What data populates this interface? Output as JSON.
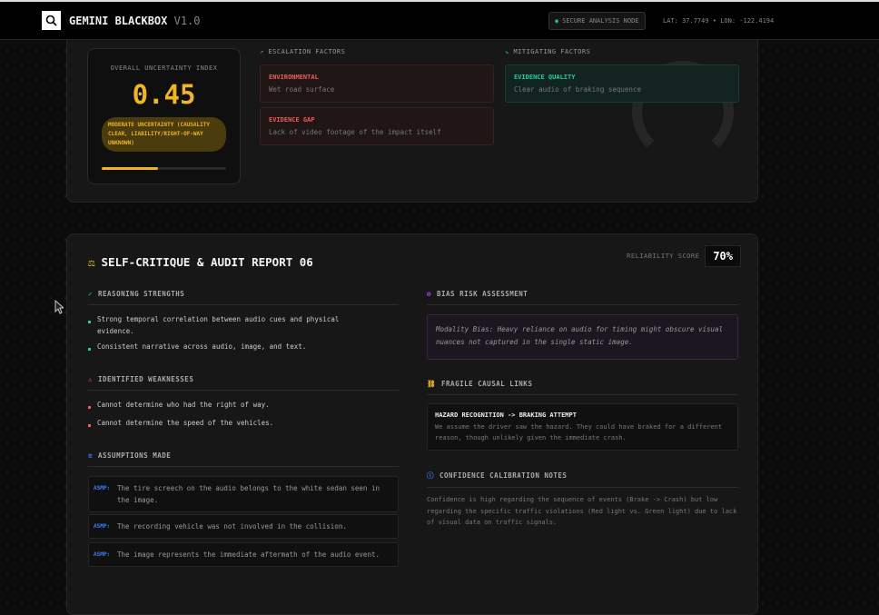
{
  "header": {
    "app_name": "GEMINI BLACKBOX",
    "version": "V1.0",
    "node_label": "SECURE ANALYSIS NODE",
    "coords": "LAT: 37.7749 • LON: -122.4194"
  },
  "uncertainty": {
    "label": "OVERALL UNCERTAINTY INDEX",
    "value": "0.45",
    "status": "MODERATE UNCERTAINTY (CAUSALITY CLEAR, LIABILITY/RIGHT-OF-WAY UNKNOWN)",
    "progress": 0.45,
    "color": "#f0b429"
  },
  "escalation": {
    "title": "ESCALATION FACTORS",
    "items": [
      {
        "title": "ENVIRONMENTAL",
        "desc": "Wet road surface"
      },
      {
        "title": "EVIDENCE GAP",
        "desc": "Lack of video footage of the impact itself"
      }
    ]
  },
  "mitigating": {
    "title": "MITIGATING FACTORS",
    "items": [
      {
        "title": "EVIDENCE QUALITY",
        "desc": "Clear audio of braking sequence"
      }
    ]
  },
  "audit": {
    "title": "SELF-CRITIQUE & AUDIT REPORT 06",
    "reliability_label": "RELIABILITY SCORE",
    "reliability_value": "70%",
    "strengths": {
      "title": "REASONING STRENGTHS",
      "items": [
        "Strong temporal correlation between audio cues and physical evidence.",
        "Consistent narrative across audio, image, and text."
      ]
    },
    "weaknesses": {
      "title": "IDENTIFIED WEAKNESSES",
      "items": [
        "Cannot determine who had the right of way.",
        "Cannot determine the speed of the vehicles."
      ]
    },
    "assumptions": {
      "title": "ASSUMPTIONS MADE",
      "tag": "ASMP:",
      "items": [
        "The tire screech on the audio belongs to the white sedan seen in the image.",
        "The recording vehicle was not involved in the collision.",
        "The image represents the immediate aftermath of the audio event."
      ]
    },
    "bias": {
      "title": "BIAS RISK ASSESSMENT",
      "text": "Modality Bias: Heavy reliance on audio for timing might obscure visual nuances not captured in the single static image."
    },
    "fragile": {
      "title": "FRAGILE CAUSAL LINKS",
      "link": "HAZARD RECOGNITION -> BRAKING ATTEMPT",
      "desc": "We assume the driver saw the hazard. They could have braked for a different reason, though unlikely given the immediate crash."
    },
    "confidence": {
      "title": "CONFIDENCE CALIBRATION NOTES",
      "text": "Confidence is high regarding the sequence of events (Brake -> Crash) but low regarding the specific traffic violations (Red light vs. Green light) due to lack of visual data on traffic signals."
    }
  }
}
